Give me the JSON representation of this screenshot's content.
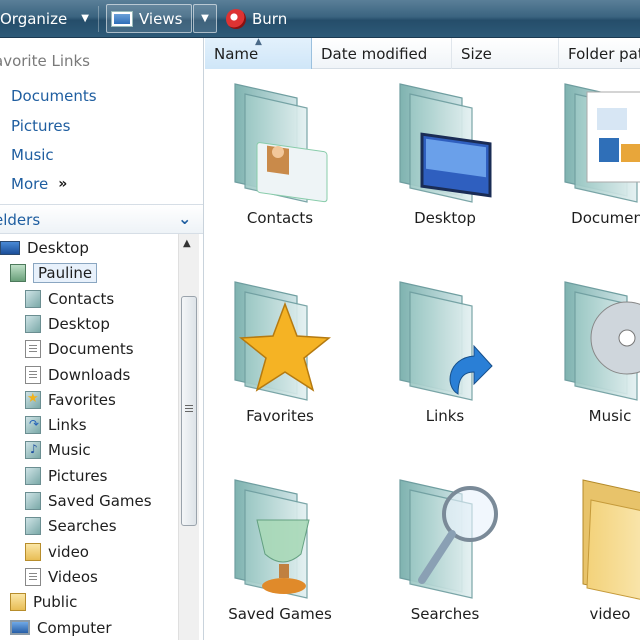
{
  "toolbar": {
    "organize": "Organize",
    "views": "Views",
    "burn": "Burn"
  },
  "nav": {
    "favorites_header": "avorite Links",
    "favorites": [
      "Documents",
      "Pictures",
      "Music"
    ],
    "more": "More",
    "folders_label": "elders",
    "tree": [
      {
        "label": "Desktop",
        "icon": "desktop-icon",
        "indent": 0
      },
      {
        "label": "Pauline",
        "icon": "user-folder-icon",
        "indent": 1,
        "selected": true
      },
      {
        "label": "Contacts",
        "icon": "contacts-icon",
        "indent": 2
      },
      {
        "label": "Desktop",
        "icon": "folder-icon",
        "indent": 2
      },
      {
        "label": "Documents",
        "icon": "documents-icon",
        "indent": 2
      },
      {
        "label": "Downloads",
        "icon": "downloads-icon",
        "indent": 2
      },
      {
        "label": "Favorites",
        "icon": "favorites-icon",
        "indent": 2
      },
      {
        "label": "Links",
        "icon": "links-icon",
        "indent": 2
      },
      {
        "label": "Music",
        "icon": "music-icon",
        "indent": 2
      },
      {
        "label": "Pictures",
        "icon": "pictures-icon",
        "indent": 2
      },
      {
        "label": "Saved Games",
        "icon": "saved-games-icon",
        "indent": 2
      },
      {
        "label": "Searches",
        "icon": "searches-icon",
        "indent": 2
      },
      {
        "label": "video",
        "icon": "yellow-folder-icon",
        "indent": 2
      },
      {
        "label": "Videos",
        "icon": "videos-icon",
        "indent": 2
      },
      {
        "label": "Public",
        "icon": "yellow-folder-icon",
        "indent": 1
      },
      {
        "label": "Computer",
        "icon": "computer-icon",
        "indent": 1
      }
    ]
  },
  "columns": [
    "Name",
    "Date modified",
    "Size",
    "Folder pat"
  ],
  "items": [
    {
      "label": "Contacts",
      "icon": "contacts-folder-icon"
    },
    {
      "label": "Desktop",
      "icon": "desktop-folder-icon"
    },
    {
      "label": "Document",
      "icon": "documents-folder-icon"
    },
    {
      "label": "Favorites",
      "icon": "favorites-folder-icon"
    },
    {
      "label": "Links",
      "icon": "links-folder-icon"
    },
    {
      "label": "Music",
      "icon": "music-folder-icon"
    },
    {
      "label": "Saved Games",
      "icon": "saved-games-folder-icon"
    },
    {
      "label": "Searches",
      "icon": "searches-folder-icon"
    },
    {
      "label": "video",
      "icon": "yellow-folder-icon"
    }
  ],
  "colors": {
    "toolbar": "#2d5a78",
    "link": "#1f5ea0",
    "selection": "#e8f1fb"
  }
}
